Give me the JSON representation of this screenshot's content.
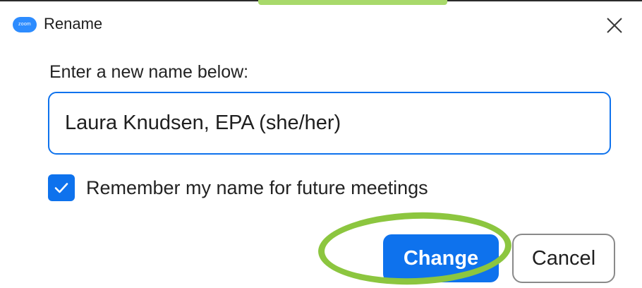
{
  "dialog": {
    "title": "Rename",
    "app_icon_text": "zoom",
    "prompt": "Enter a new name below:",
    "name_value": "Laura Knudsen, EPA (she/her)",
    "remember": {
      "label": "Remember my name for future meetings",
      "checked": true
    },
    "buttons": {
      "change": "Change",
      "cancel": "Cancel"
    }
  },
  "icons": {
    "app": "zoom-app-icon",
    "close": "close-icon",
    "check": "checkmark-icon"
  },
  "colors": {
    "accent": "#0e72ed",
    "annotation": "#8cc63f",
    "app_icon": "#2d8cff"
  }
}
